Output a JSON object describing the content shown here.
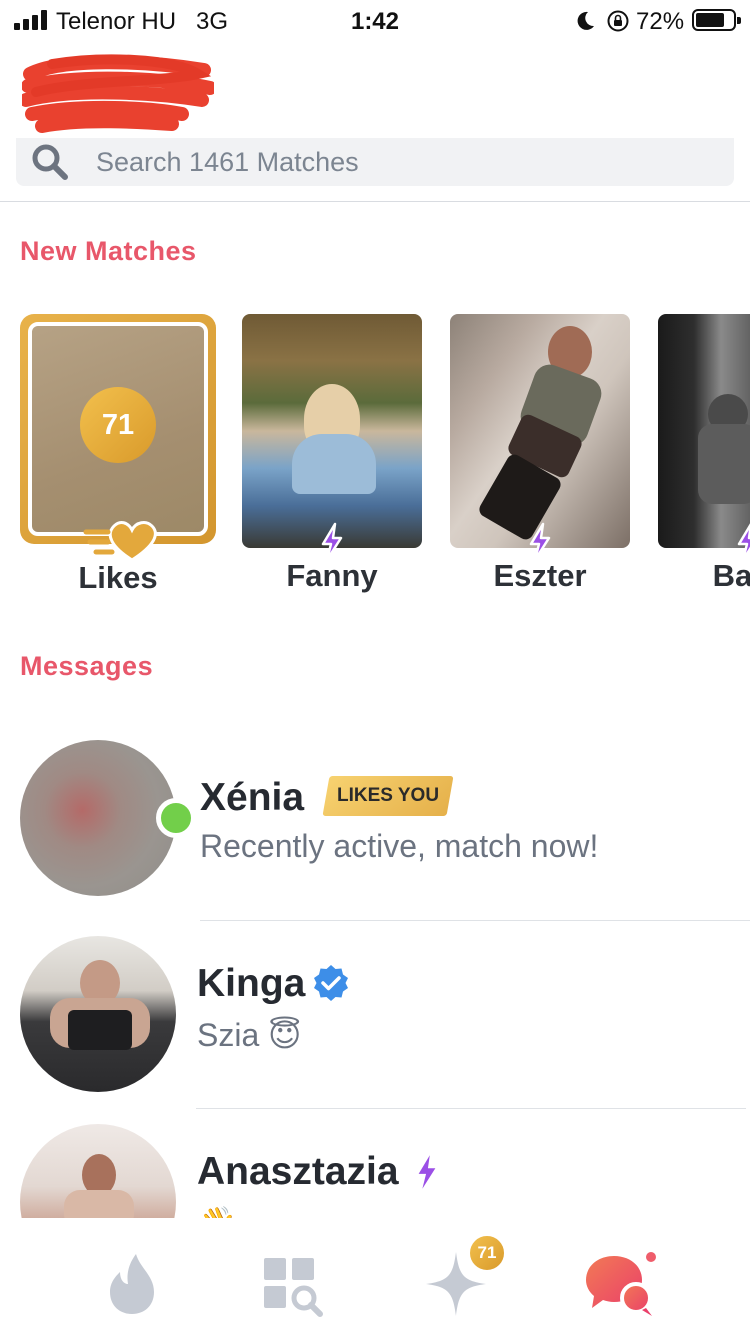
{
  "status_bar": {
    "carrier": "Telenor HU",
    "network": "3G",
    "time": "1:42",
    "battery_percent": "72%"
  },
  "search": {
    "placeholder": "Search 1461 Matches"
  },
  "new_matches": {
    "title": "New Matches",
    "likes": {
      "count": "71",
      "label": "Likes"
    },
    "items": [
      {
        "name": "Fanny",
        "super": true
      },
      {
        "name": "Eszter",
        "super": true
      },
      {
        "name": "Barb",
        "super": true
      }
    ]
  },
  "messages": {
    "title": "Messages",
    "items": [
      {
        "name": "Xénia",
        "badge": "LIKES YOU",
        "preview": "Recently active, match now!",
        "online": true
      },
      {
        "name": "Kinga",
        "verified": true,
        "preview": "Szia 😇"
      },
      {
        "name": "Anasztazia",
        "super": true,
        "preview": "👋"
      }
    ]
  },
  "tab_bar": {
    "items": [
      {
        "icon": "flame-icon",
        "active": false
      },
      {
        "icon": "explore-icon",
        "active": false
      },
      {
        "icon": "sparkle-icon",
        "active": false,
        "badge": "71"
      },
      {
        "icon": "chat-icon",
        "active": true
      }
    ]
  },
  "colors": {
    "accent": "#e8576a",
    "gold": "#e3a83c",
    "online": "#72cf4a",
    "super_like": "#9b4fe6",
    "verified": "#3d8ee8"
  }
}
